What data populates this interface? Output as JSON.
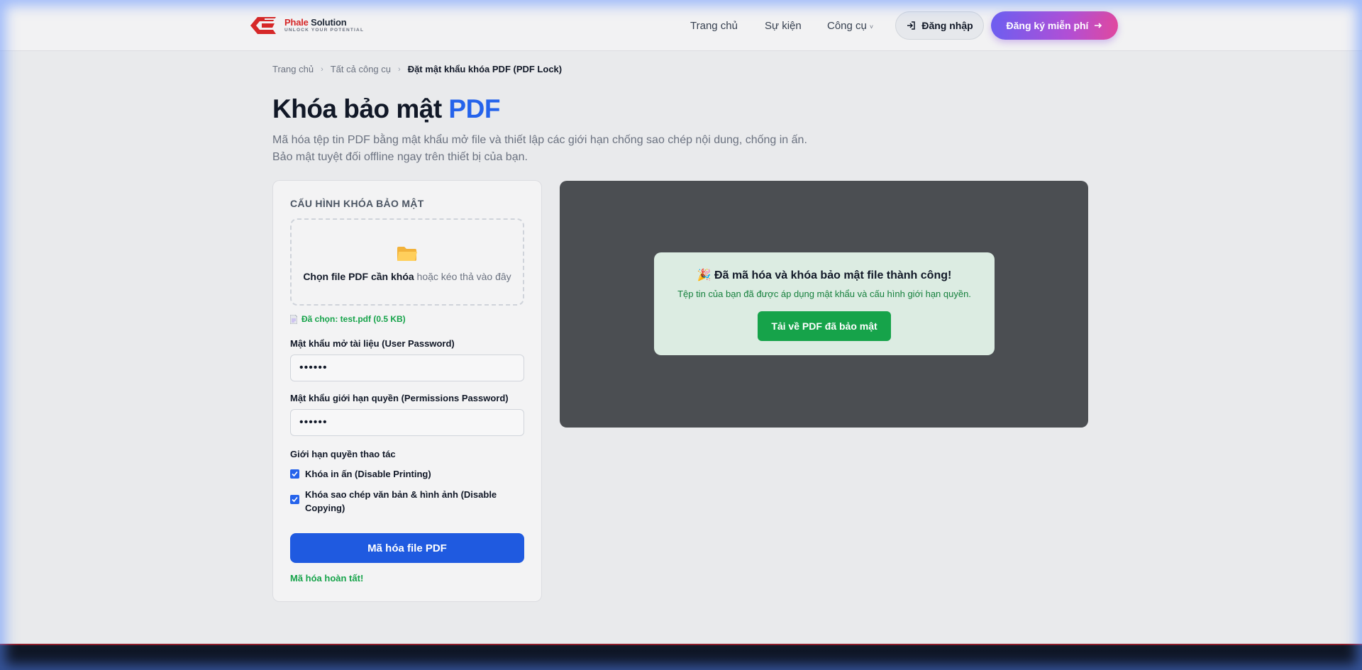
{
  "brand": {
    "name_red": "Phale",
    "name_rest": " Solution",
    "tagline": "UNLOCK YOUR POTENTIAL"
  },
  "nav": {
    "home": "Trang chủ",
    "events": "Sự kiện",
    "tools": "Công cụ",
    "login": "Đăng nhập",
    "signup": "Đăng ký miễn phí"
  },
  "breadcrumb": {
    "home": "Trang chủ",
    "all_tools": "Tất cả công cụ",
    "current": "Đặt mật khẩu khóa PDF (PDF Lock)"
  },
  "page": {
    "title_main": "Khóa bảo mật ",
    "title_accent": "PDF",
    "desc_line1": "Mã hóa tệp tin PDF bằng mật khẩu mở file và thiết lập các giới hạn chống sao chép nội dung, chống in ấn.",
    "desc_line2": "Bảo mật tuyệt đối offline ngay trên thiết bị của bạn."
  },
  "config": {
    "heading": "CẤU HÌNH KHÓA BẢO MẬT",
    "drop_strong": "Chọn file PDF cần khóa",
    "drop_rest": " hoặc kéo thả vào đây",
    "file_selected": "Đã chọn: test.pdf (0.5 KB)",
    "user_pw_label": "Mật khẩu mở tài liệu (User Password)",
    "user_pw_value": "••••••",
    "perm_pw_label": "Mật khẩu giới hạn quyền (Permissions Password)",
    "perm_pw_value": "••••••",
    "restrict_label": "Giới hạn quyền thao tác",
    "disable_printing": "Khóa in ấn (Disable Printing)",
    "disable_copying": "Khóa sao chép văn bản & hình ảnh (Disable Copying)",
    "encrypt_button": "Mã hóa file PDF",
    "status": "Mã hóa hoàn tất!"
  },
  "result": {
    "title": "🎉 Đã mã hóa và khóa bảo mật file thành công!",
    "subtitle": "Tệp tin của bạn đã được áp dụng mật khẩu và cấu hình giới hạn quyền.",
    "download_button": "Tải về PDF đã bảo mật"
  },
  "colors": {
    "accent": "#2563eb",
    "success": "#16a34a",
    "brand_red": "#d62828"
  }
}
